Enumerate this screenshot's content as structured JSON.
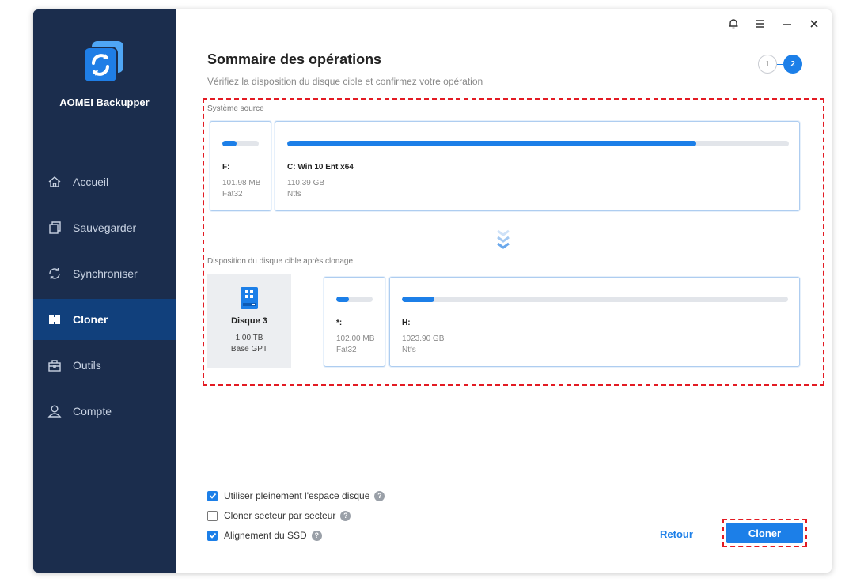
{
  "app": {
    "name": "AOMEI Backupper"
  },
  "sidebar": {
    "items": [
      {
        "label": "Accueil",
        "icon": "home-icon"
      },
      {
        "label": "Sauvegarder",
        "icon": "copy-icon"
      },
      {
        "label": "Synchroniser",
        "icon": "sync-icon"
      },
      {
        "label": "Cloner",
        "icon": "clone-icon",
        "active": true
      },
      {
        "label": "Outils",
        "icon": "toolbox-icon"
      },
      {
        "label": "Compte",
        "icon": "user-icon"
      }
    ]
  },
  "header": {
    "title": "Sommaire des opérations",
    "subtitle": "Vérifiez la disposition du disque cible et confirmez votre opération",
    "steps": [
      "1",
      "2"
    ],
    "current_step": 2
  },
  "source": {
    "label": "Système source",
    "partitions": [
      {
        "name": "F:",
        "size": "101.98 MB",
        "fs": "Fat32",
        "used": 0.4
      },
      {
        "name": "C: Win 10 Ent x64",
        "size": "110.39 GB",
        "fs": "Ntfs",
        "used": 0.815
      }
    ]
  },
  "target": {
    "label": "Disposition du disque cible après clonage",
    "disk": {
      "name": "Disque 3",
      "size": "1.00 TB",
      "type": "Base GPT"
    },
    "partitions": [
      {
        "name": "*:",
        "size": "102.00 MB",
        "fs": "Fat32",
        "used": 0.35
      },
      {
        "name": "H:",
        "size": "1023.90 GB",
        "fs": "Ntfs",
        "used": 0.085
      }
    ]
  },
  "options": [
    {
      "label": "Utiliser pleinement l'espace disque",
      "checked": true
    },
    {
      "label": "Cloner secteur par secteur",
      "checked": false
    },
    {
      "label": "Alignement du SSD",
      "checked": true
    }
  ],
  "buttons": {
    "back": "Retour",
    "clone": "Cloner"
  },
  "colors": {
    "sidebar": "#1b2d4d",
    "active_nav": "#11407c",
    "accent": "#1c7fe8",
    "highlight": "#e31b23"
  }
}
